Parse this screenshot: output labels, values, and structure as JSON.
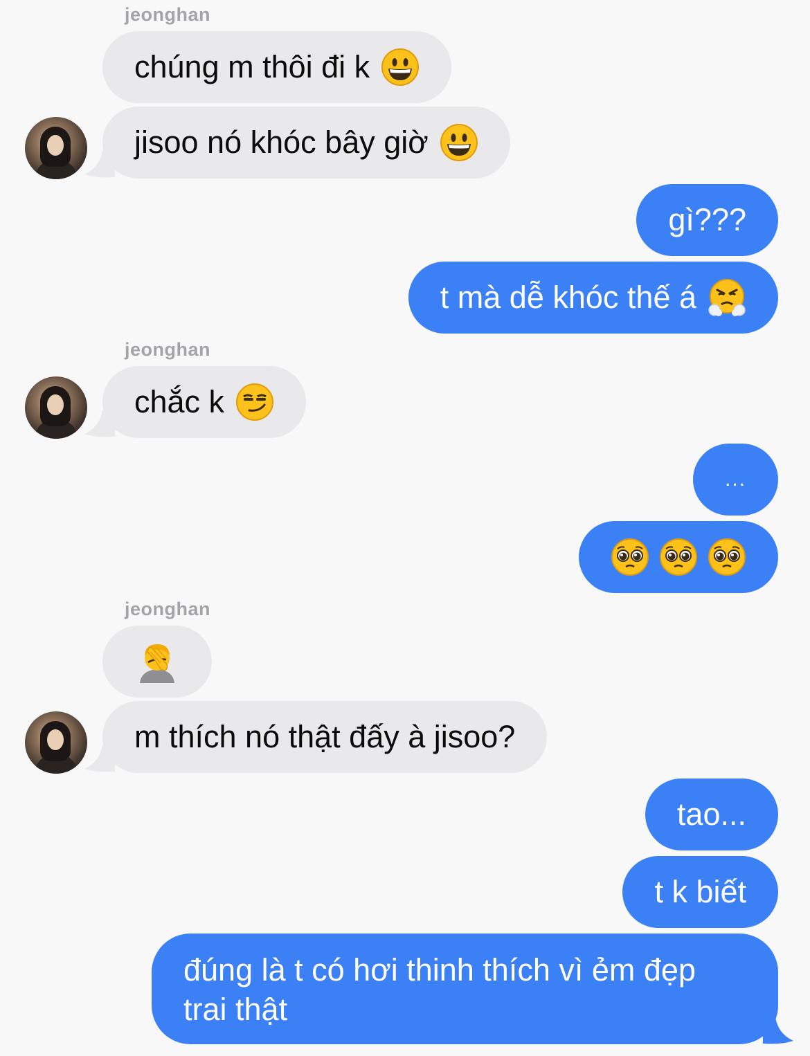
{
  "sender": "jeonghan",
  "messages": [
    {
      "from": "them",
      "text": "chúng m thôi đi k",
      "emoji": "grinning-face"
    },
    {
      "from": "them",
      "text": "jisoo nó khóc bây giờ",
      "emoji": "grinning-face"
    },
    {
      "from": "me",
      "text": "gì???"
    },
    {
      "from": "me",
      "text": "t mà dễ khóc thế á",
      "emoji": "face-with-steam-from-nose"
    },
    {
      "from": "them",
      "text": "chắc k",
      "emoji": "smirking-face"
    },
    {
      "from": "me",
      "text": "..."
    },
    {
      "from": "me",
      "emojis": [
        "pleading-face",
        "pleading-face",
        "pleading-face"
      ]
    },
    {
      "from": "them",
      "emoji": "person-facepalming"
    },
    {
      "from": "them",
      "text": "m thích nó thật đấy à jisoo?"
    },
    {
      "from": "me",
      "text": "tao..."
    },
    {
      "from": "me",
      "text": "t k biết"
    },
    {
      "from": "me",
      "text": "đúng là t có hơi thinh thích vì ẻm đẹp trai thật"
    }
  ],
  "colors": {
    "incoming_bubble": "#e9e9eb",
    "outgoing_bubble": "#3b80f5",
    "background": "#f8f8f9",
    "sender_name": "#a3a3a8"
  }
}
